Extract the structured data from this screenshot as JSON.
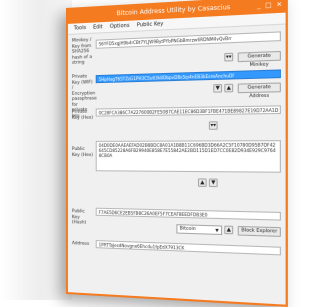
{
  "window": {
    "title": "Bitcoin Address Utility by Casascius",
    "controls": [
      "_",
      "□",
      "✕"
    ]
  },
  "menu": [
    "Tools",
    "Edit",
    "Options",
    "Public Key"
  ],
  "minikey": {
    "label": "Minikey / Key from SHA256 hash of a string",
    "value": "S6YFD5xgjH9b4rCBt7YLJW9BytPYbPNGbBmrzw6RDNM4vQvBrr",
    "button": "Generate Minikey"
  },
  "private_key_wif": {
    "label": "Private Key (WIF) / Encryption passphrase for private key",
    "value": "5HpHagT65TZzG1PH3CSu63k8DbpvD8s5ip4nEB3kEsreAnchuDf",
    "button": "Generate Address"
  },
  "private_key_hex": {
    "label": "Private Key (Hex)",
    "value": "0C28FCA386C7A227600B2FE50B7CAE11EC86D3BF1FBE471BE89827E19D72AA1D"
  },
  "public_key_hex": {
    "label": "Public Key (Hex)",
    "value": "04D0DE0AAEAEFAD02B8BDC8A01A1B8B11C696BD3D66A2C5F10780D95B7DF42645CD85228A6FB29940E858E7E55842AE2BD115D1ED7CC0E82D934E929C97648CB0A"
  },
  "public_key_hash": {
    "label": "Public Key (Hash)",
    "value": "F7AE5D6CE2EB5FB8C26A0EF5F7CEAF8EEDFDB3E0"
  },
  "address_type": {
    "selected": "Bitcoin",
    "button": "Block Explorer"
  },
  "address": {
    "label": "Address",
    "value": "1PRTTaJesdNovgne6Ehcdu1fpEdX7913CK"
  },
  "icons": {
    "arrow_down": "▼",
    "arrow_up": "▲",
    "double_down": "▾▾"
  }
}
